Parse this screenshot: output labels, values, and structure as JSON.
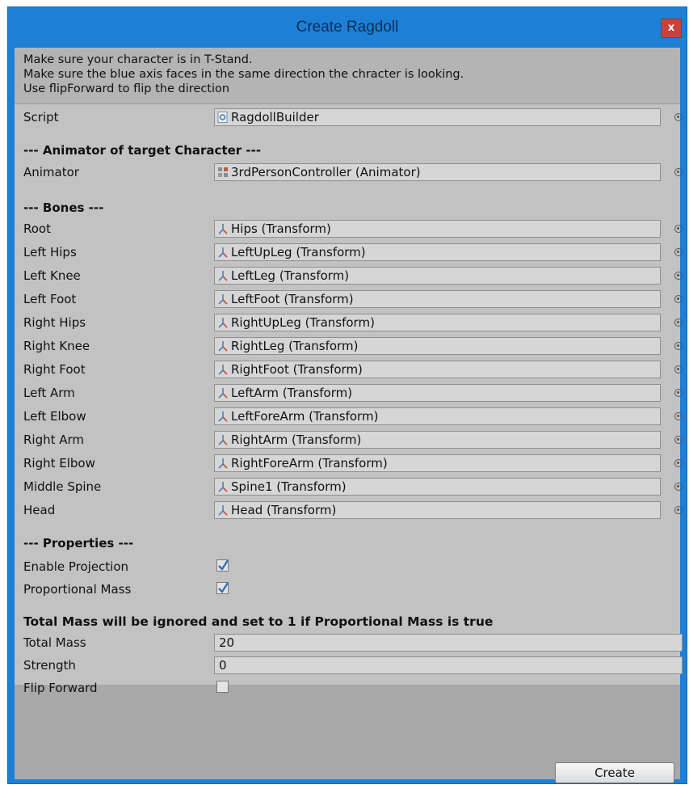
{
  "window": {
    "title": "Create Ragdoll",
    "close_label": "x"
  },
  "help": {
    "lines": [
      "Make sure your character is in T-Stand.",
      "Make sure the blue axis faces in the same direction the chracter is looking.",
      "Use flipForward to flip the direction"
    ]
  },
  "script": {
    "label": "Script",
    "value": "RagdollBuilder",
    "icon": "script-icon"
  },
  "animator_section": {
    "header": "--- Animator of target Character ---",
    "label": "Animator",
    "value": "3rdPersonController (Animator)",
    "icon": "animator-icon"
  },
  "bones_section": {
    "header": "--- Bones ---",
    "items": [
      {
        "label": "Root",
        "value": "Hips (Transform)"
      },
      {
        "label": "Left Hips",
        "value": "LeftUpLeg (Transform)"
      },
      {
        "label": "Left Knee",
        "value": "LeftLeg (Transform)"
      },
      {
        "label": "Left Foot",
        "value": "LeftFoot (Transform)"
      },
      {
        "label": "Right Hips",
        "value": "RightUpLeg (Transform)"
      },
      {
        "label": "Right Knee",
        "value": "RightLeg (Transform)"
      },
      {
        "label": "Right Foot",
        "value": "RightFoot (Transform)"
      },
      {
        "label": "Left Arm",
        "value": "LeftArm (Transform)"
      },
      {
        "label": "Left Elbow",
        "value": "LeftForeArm (Transform)"
      },
      {
        "label": "Right Arm",
        "value": "RightArm (Transform)"
      },
      {
        "label": "Right Elbow",
        "value": "RightForeArm (Transform)"
      },
      {
        "label": "Middle Spine",
        "value": "Spine1 (Transform)"
      },
      {
        "label": "Head",
        "value": "Head (Transform)"
      }
    ]
  },
  "properties_section": {
    "header": "--- Properties ---",
    "enable_projection": {
      "label": "Enable Projection",
      "checked": true
    },
    "proportional_mass": {
      "label": "Proportional Mass",
      "checked": true
    }
  },
  "mass_section": {
    "note": "Total Mass will be ignored and set to 1 if Proportional Mass is true",
    "total_mass": {
      "label": "Total Mass",
      "value": "20"
    },
    "strength": {
      "label": "Strength",
      "value": "0"
    },
    "flip_forward": {
      "label": "Flip Forward",
      "checked": false
    }
  },
  "footer": {
    "create_label": "Create"
  },
  "colors": {
    "title_bar": "#1d7fd6",
    "close_button": "#c9413b",
    "panel": "#c2c2c2",
    "help_box": "#b4b4b4",
    "field": "#d6d6d6",
    "checkmark": "#3a6fb0"
  }
}
